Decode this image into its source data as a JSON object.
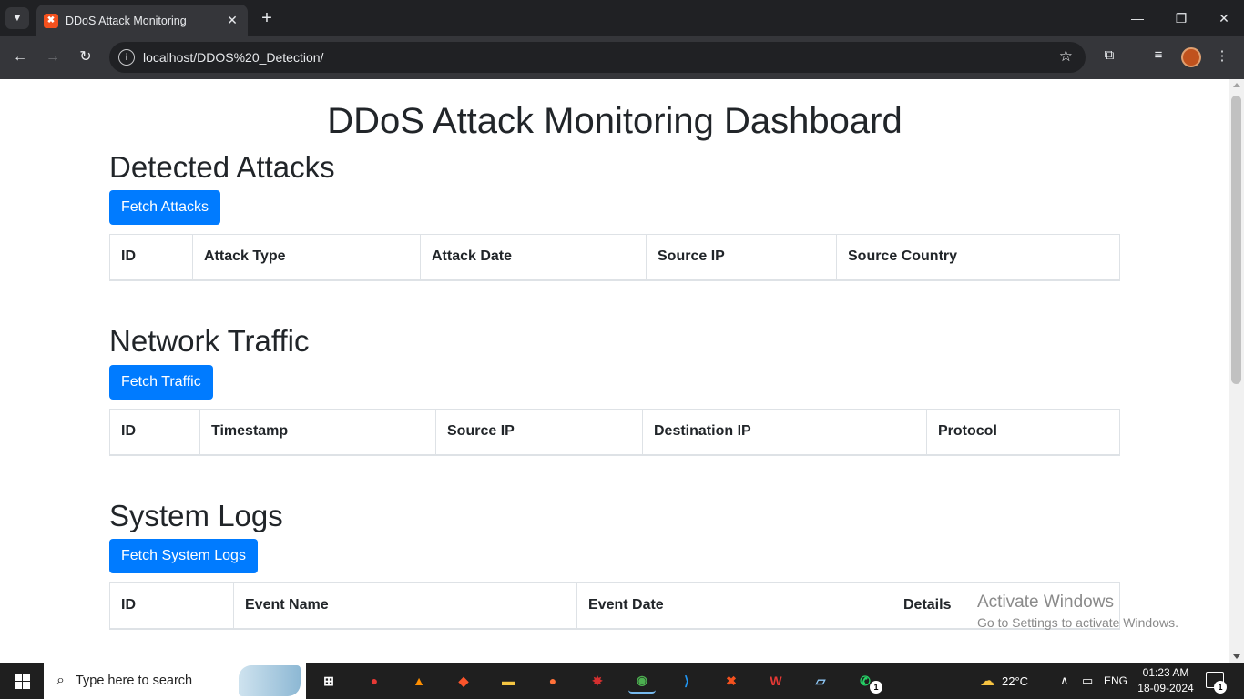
{
  "browser": {
    "tab_title": "DDoS Attack Monitoring",
    "url": "localhost/DDOS%20_Detection/",
    "new_tab": "+",
    "close_tab": "✕"
  },
  "page": {
    "title": "DDoS Attack Monitoring Dashboard",
    "sections": [
      {
        "title": "Detected Attacks",
        "button": "Fetch Attacks",
        "columns": [
          "ID",
          "Attack Type",
          "Attack Date",
          "Source IP",
          "Source Country"
        ]
      },
      {
        "title": "Network Traffic",
        "button": "Fetch Traffic",
        "columns": [
          "ID",
          "Timestamp",
          "Source IP",
          "Destination IP",
          "Protocol"
        ]
      },
      {
        "title": "System Logs",
        "button": "Fetch System Logs",
        "columns": [
          "ID",
          "Event Name",
          "Event Date",
          "Details"
        ]
      }
    ]
  },
  "watermark": {
    "line1": "Activate Windows",
    "line2": "Go to Settings to activate Windows."
  },
  "taskbar": {
    "search_placeholder": "Type here to search",
    "weather": "22°C",
    "language": "ENG",
    "time": "01:23 AM",
    "date": "18-09-2024",
    "notification_count": "1",
    "whatsapp_badge": "1"
  },
  "colors": {
    "primary": "#007bff",
    "browser_dark": "#202124",
    "toolbar": "#35363a"
  }
}
